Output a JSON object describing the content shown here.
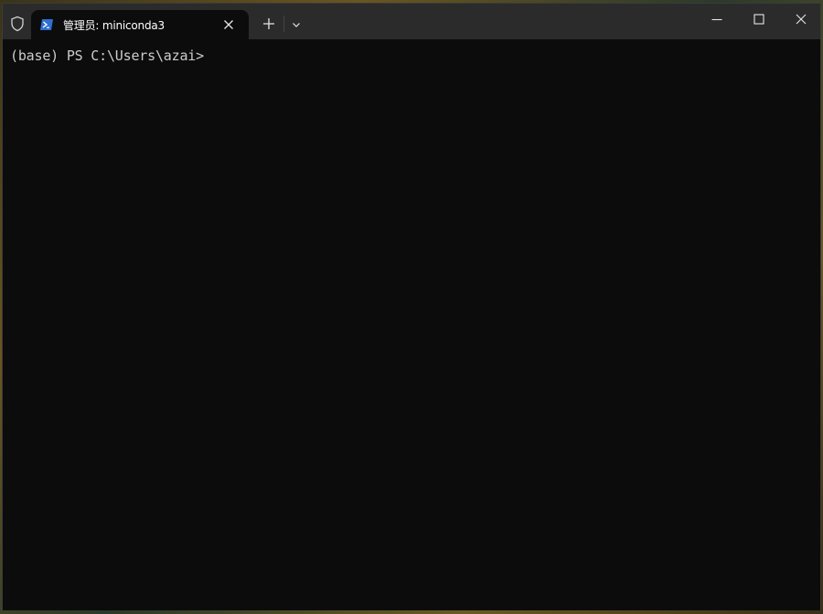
{
  "window": {
    "tab_title": "管理员: miniconda3",
    "tab_icon": "powershell-icon"
  },
  "titlebar": {
    "shield_icon": "shield-icon",
    "new_tab_icon": "plus-icon",
    "dropdown_icon": "chevron-down-icon",
    "minimize_icon": "minimize-icon",
    "maximize_icon": "maximize-icon",
    "close_icon": "close-icon"
  },
  "terminal": {
    "prompt": "(base) PS C:\\Users\\azai>"
  },
  "colors": {
    "titlebar_bg": "#2b2b2b",
    "terminal_bg": "#0c0c0c",
    "text": "#cccccc",
    "accent_blue": "#2f6fd1"
  }
}
